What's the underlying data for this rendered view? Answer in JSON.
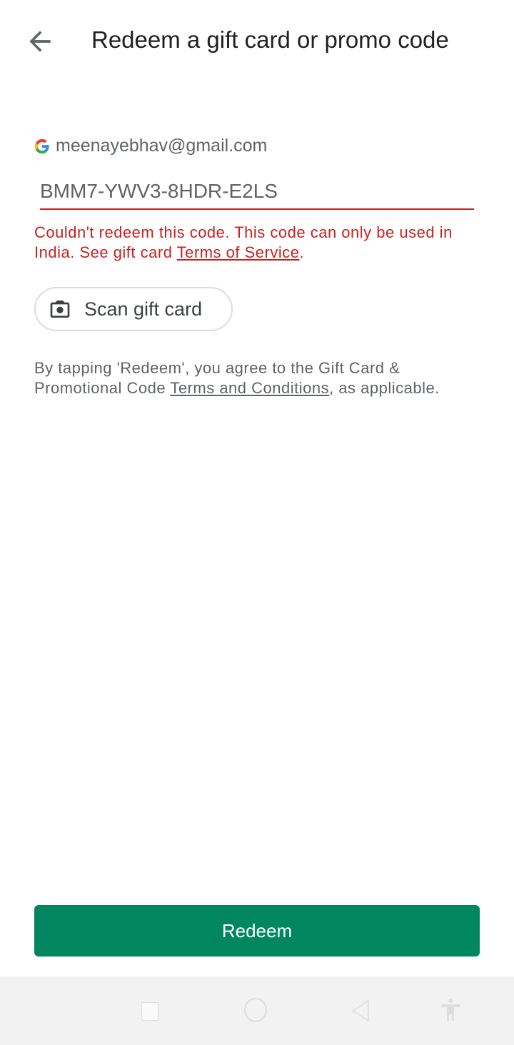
{
  "header": {
    "title": "Redeem a gift card or promo code",
    "back_icon": "arrow-left-icon"
  },
  "account": {
    "icon": "google-g-icon",
    "email": "meenayebhav@gmail.com"
  },
  "code_input": {
    "value": "BMM7-YWV3-8HDR-E2LS"
  },
  "error": {
    "text": "Couldn't redeem this code. This code can only be used in India. See gift card ",
    "link": "Terms of Service",
    "suffix": ".",
    "color": "#c5221f"
  },
  "scan_button": {
    "label": "Scan gift card",
    "icon": "camera-icon"
  },
  "terms": {
    "text": "By tapping 'Redeem', you agree to the Gift Card & Promotional Code ",
    "link": "Terms and Conditions",
    "suffix": ", as applicable."
  },
  "redeem_button": {
    "label": "Redeem",
    "color": "#01875f"
  },
  "navbar": {
    "icons": [
      "recents-square-icon",
      "home-circle-icon",
      "back-triangle-icon",
      "accessibility-icon"
    ]
  }
}
